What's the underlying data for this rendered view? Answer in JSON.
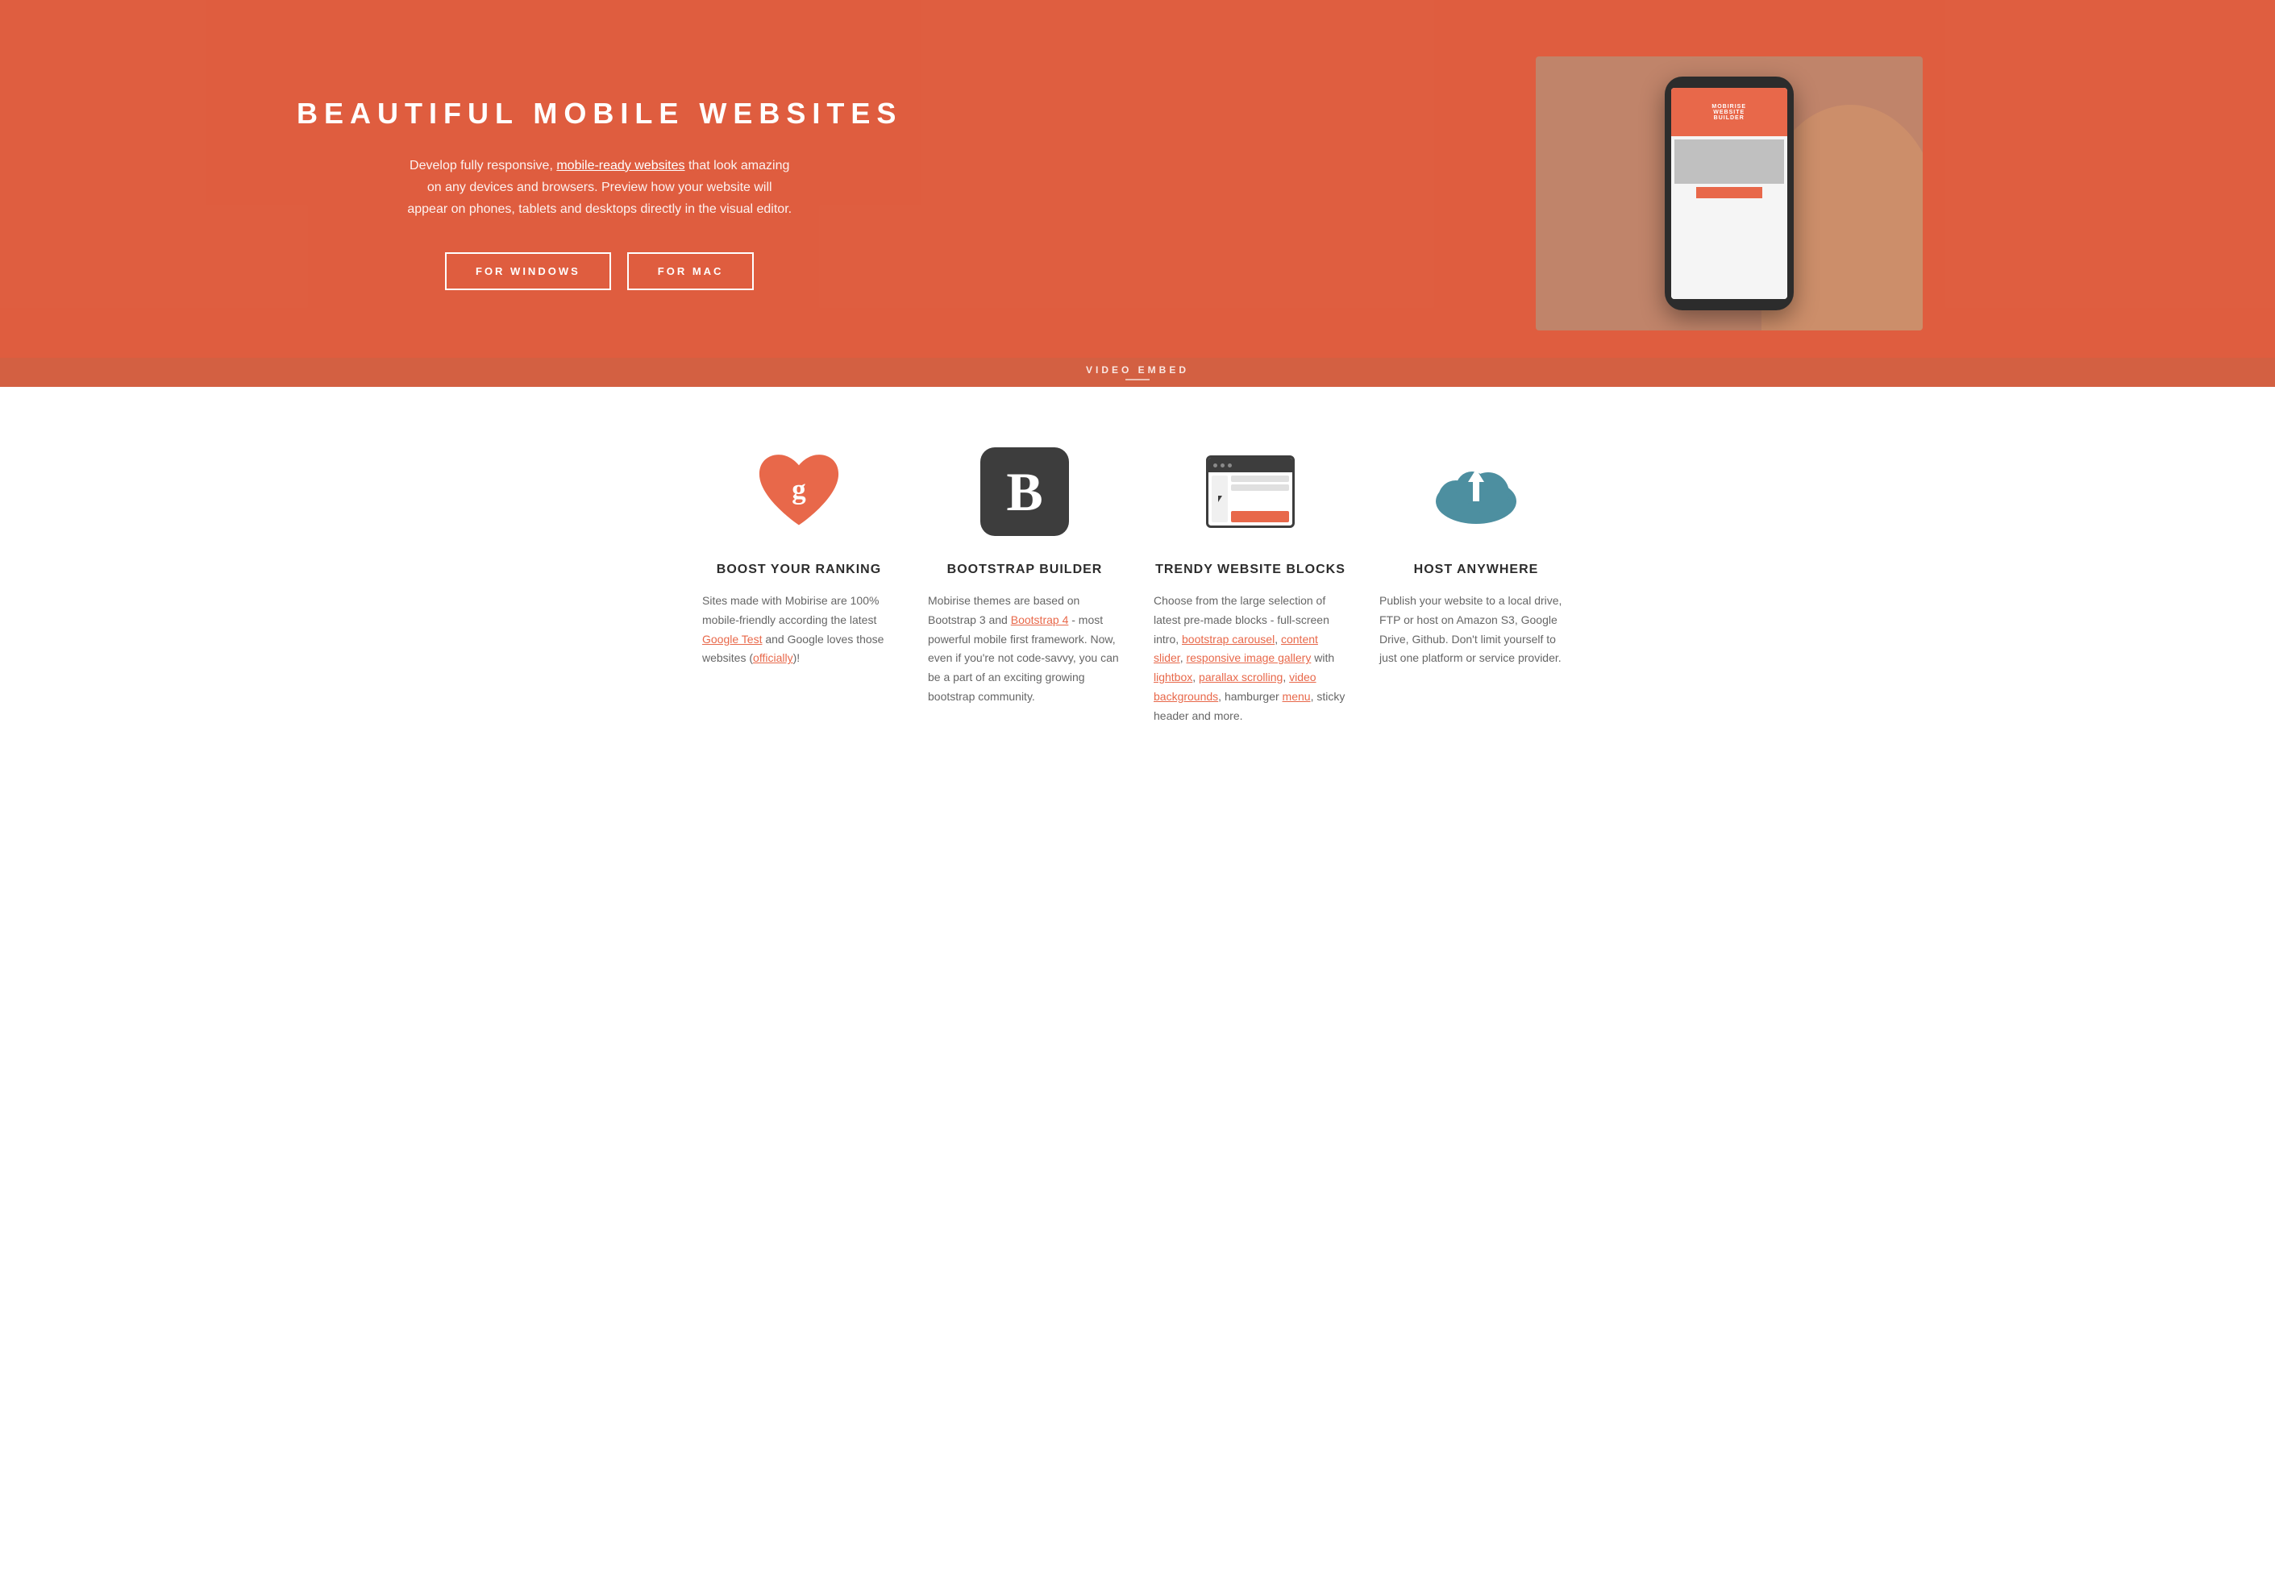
{
  "hero": {
    "title": "BEAUTIFUL MOBILE WEBSITES",
    "description_start": "Develop fully responsive, ",
    "description_link": "mobile-ready websites",
    "description_end": " that look amazing on any devices and browsers. Preview how your website will appear on phones, tablets and desktops directly in the visual editor.",
    "btn_windows": "FOR WINDOWS",
    "btn_mac": "FOR MAC",
    "video_embed_label": "VIDEO EMBED",
    "phone_screen_title_line1": "MOBIRISE",
    "phone_screen_title_line2": "WEBSITE",
    "phone_screen_title_line3": "BUILDER"
  },
  "features": [
    {
      "id": "boost-ranking",
      "title": "BOOST YOUR RANKING",
      "icon": "heart-google",
      "description_parts": [
        {
          "type": "text",
          "value": "Sites made with Mobirise are 100% mobile-friendly according the latest "
        },
        {
          "type": "link",
          "value": "Google Test"
        },
        {
          "type": "text",
          "value": " and Google loves those websites ("
        },
        {
          "type": "link",
          "value": "officially"
        },
        {
          "type": "text",
          "value": ")!"
        }
      ]
    },
    {
      "id": "bootstrap-builder",
      "title": "BOOTSTRAP BUILDER",
      "icon": "bootstrap-b",
      "description_parts": [
        {
          "type": "text",
          "value": "Mobirise themes are based on Bootstrap 3 and "
        },
        {
          "type": "link",
          "value": "Bootstrap 4"
        },
        {
          "type": "text",
          "value": " - most powerful mobile first framework. Now, even if you're not code-savvy, you can be a part of an exciting growing bootstrap community."
        }
      ]
    },
    {
      "id": "trendy-blocks",
      "title": "TRENDY WEBSITE BLOCKS",
      "icon": "browser-window",
      "description_parts": [
        {
          "type": "text",
          "value": "Choose from the large selection of latest pre-made blocks - full-screen intro, "
        },
        {
          "type": "link",
          "value": "bootstrap carousel"
        },
        {
          "type": "text",
          "value": ", "
        },
        {
          "type": "link",
          "value": "content slider"
        },
        {
          "type": "text",
          "value": ", "
        },
        {
          "type": "link",
          "value": "responsive image gallery"
        },
        {
          "type": "text",
          "value": " with "
        },
        {
          "type": "link",
          "value": "lightbox"
        },
        {
          "type": "text",
          "value": ", "
        },
        {
          "type": "link",
          "value": "parallax scrolling"
        },
        {
          "type": "text",
          "value": ", "
        },
        {
          "type": "link",
          "value": "video backgrounds"
        },
        {
          "type": "text",
          "value": ", hamburger "
        },
        {
          "type": "link",
          "value": "menu"
        },
        {
          "type": "text",
          "value": ", sticky header and more."
        }
      ]
    },
    {
      "id": "host-anywhere",
      "title": "HOST ANYWHERE",
      "icon": "cloud-upload",
      "description_parts": [
        {
          "type": "text",
          "value": "Publish your website to a local drive, FTP or host on Amazon S3, Google Drive, Github. Don't limit yourself to just one platform or service provider."
        }
      ]
    }
  ]
}
